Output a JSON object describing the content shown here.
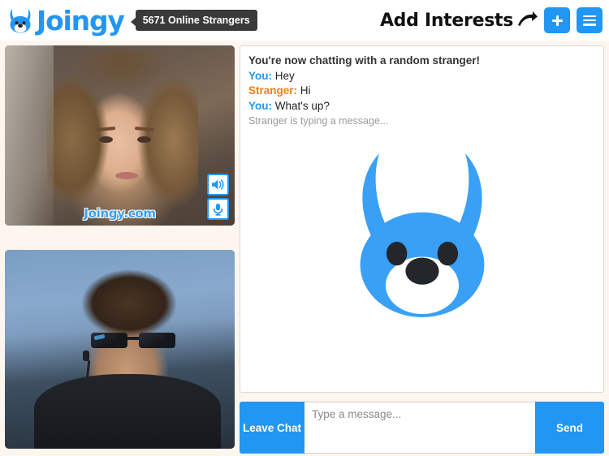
{
  "header": {
    "brand_name": "Joingy",
    "logo_icon": "bunny-logo-icon",
    "online_badge": "5671 Online Strangers",
    "add_interests_label": "Add Interests",
    "arrow_icon": "curved-arrow-right-icon",
    "add_button_icon": "plus-icon",
    "menu_button_icon": "hamburger-menu-icon",
    "accent_color": "#2196f3",
    "badge_bg_color": "#3a3a3a"
  },
  "video": {
    "remote_watermark": "Joingy.com",
    "controls": [
      {
        "name": "speaker-icon",
        "label": "Volume"
      },
      {
        "name": "microphone-icon",
        "label": "Microphone"
      }
    ]
  },
  "chat": {
    "system_message": "You're now chatting with a random stranger!",
    "messages": [
      {
        "who": "You:",
        "role": "you",
        "text": "Hey"
      },
      {
        "who": "Stranger:",
        "role": "stranger",
        "text": "Hi"
      },
      {
        "who": "You:",
        "role": "you",
        "text": "What's up?"
      }
    ],
    "typing_indicator": "Stranger is typing a message...",
    "mascot_icon": "bunny-mascot-icon",
    "you_color": "#2196f3",
    "stranger_color": "#f08010"
  },
  "input_bar": {
    "leave_label": "Leave Chat",
    "message_value": "",
    "message_placeholder": "Type a message...",
    "send_label": "Send"
  }
}
